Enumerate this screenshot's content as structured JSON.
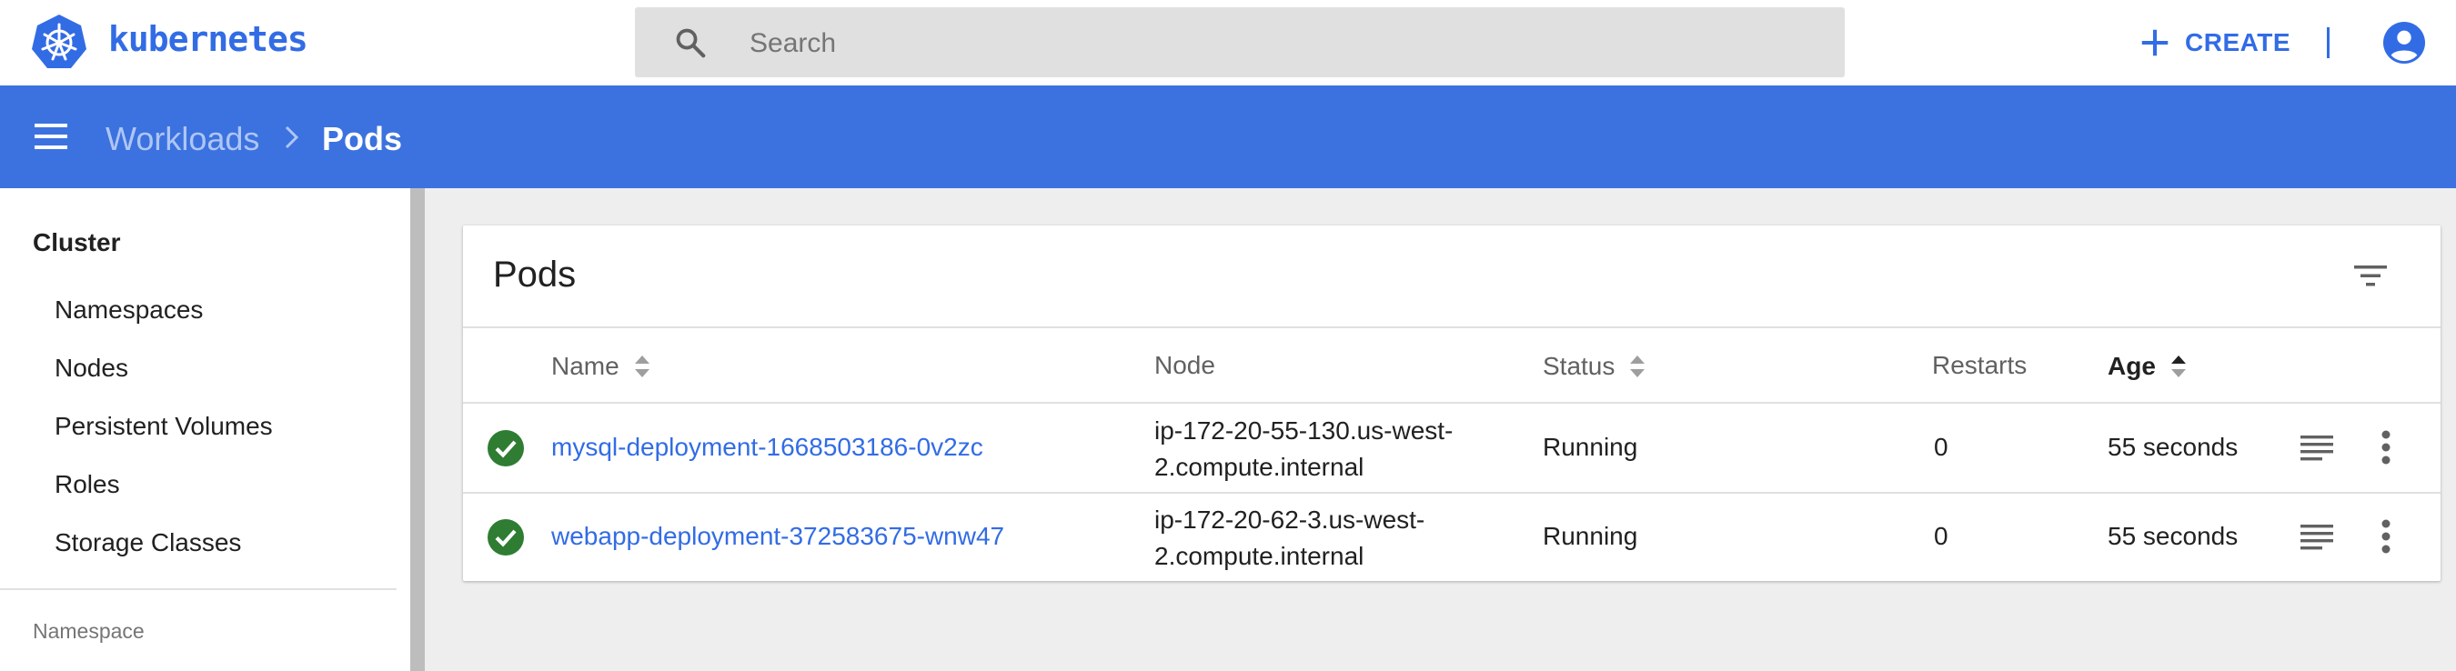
{
  "app": {
    "brand": "kubernetes"
  },
  "search": {
    "placeholder": "Search",
    "value": ""
  },
  "header_actions": {
    "create_label": "CREATE"
  },
  "breadcrumb": {
    "parent": "Workloads",
    "current": "Pods"
  },
  "sidebar": {
    "heading": "Cluster",
    "items": [
      {
        "label": "Namespaces"
      },
      {
        "label": "Nodes"
      },
      {
        "label": "Persistent Volumes"
      },
      {
        "label": "Roles"
      },
      {
        "label": "Storage Classes"
      }
    ],
    "section_label": "Namespace"
  },
  "card": {
    "title": "Pods"
  },
  "table": {
    "columns": [
      {
        "label": "Name",
        "sortable": true
      },
      {
        "label": "Node",
        "sortable": false
      },
      {
        "label": "Status",
        "sortable": true
      },
      {
        "label": "Restarts",
        "sortable": false
      },
      {
        "label": "Age",
        "sortable": true,
        "sort": "ascending"
      }
    ],
    "rows": [
      {
        "name": "mysql-deployment-1668503186-0v2zc",
        "node": "ip-172-20-55-130.us-west-2.compute.internal",
        "status": "Running",
        "restarts": "0",
        "age": "55 seconds"
      },
      {
        "name": "webapp-deployment-372583675-wnw47",
        "node": "ip-172-20-62-3.us-west-2.compute.internal",
        "status": "Running",
        "restarts": "0",
        "age": "55 seconds"
      }
    ]
  },
  "colors": {
    "brand_blue": "#326ce5",
    "title_bar": "#3c72df",
    "status_ok": "#2e7d32",
    "breadcrumb_parent": "#aec6f4",
    "page_background": "#eeeeee"
  },
  "icons": {
    "logo": "kubernetes-helm-icon",
    "search": "search-icon",
    "create": "plus-icon",
    "account": "account-circle-icon",
    "menu": "hamburger-menu-icon",
    "breadcrumb_separator": "chevron-right-icon",
    "filter": "filter-icon",
    "sort": "sort-arrows-icon",
    "status": "check-circle-icon",
    "logs": "logs-icon",
    "actions": "more-vert-icon"
  }
}
